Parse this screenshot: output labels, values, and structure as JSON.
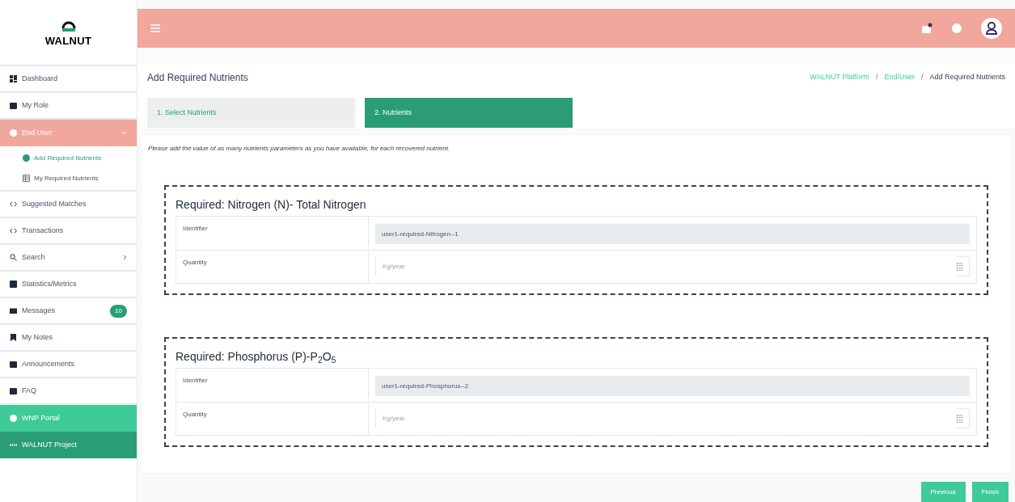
{
  "logo": {
    "text": "WALNUT"
  },
  "sidebar": {
    "items": [
      {
        "kind": "item",
        "label": "Dashboard",
        "selected": false
      },
      {
        "kind": "item",
        "label": "My Role",
        "selected": false
      },
      {
        "kind": "item",
        "label": "End User",
        "selected": true,
        "expanded": true,
        "children": [
          {
            "label": "Add Required Nutrients",
            "selected": true
          },
          {
            "label": "My Required Nutrients",
            "selected": false
          }
        ]
      },
      {
        "kind": "item",
        "label": "Suggested Matches",
        "selected": false
      },
      {
        "kind": "item",
        "label": "Transactions",
        "selected": false
      },
      {
        "kind": "item",
        "label": "Search",
        "selected": false,
        "submenu": true
      },
      {
        "kind": "item",
        "label": "Statistics/Metrics",
        "selected": false
      },
      {
        "kind": "item",
        "label": "Messages",
        "selected": false,
        "badge": "10"
      },
      {
        "kind": "item",
        "label": "My Notes",
        "selected": false
      },
      {
        "kind": "item",
        "label": "Announcements",
        "selected": false
      },
      {
        "kind": "item",
        "label": "FAQ",
        "selected": false
      },
      {
        "kind": "portal",
        "label": "WNP Portal",
        "selected": false
      },
      {
        "kind": "project",
        "label": "WALNUT Project",
        "selected": false
      }
    ]
  },
  "page": {
    "title": "Add Required Nutrients",
    "breadcrumb": [
      {
        "label": "WALNUT Platform",
        "link": true
      },
      {
        "label": "/",
        "kind": "separator"
      },
      {
        "label": "End/User",
        "link": true
      },
      {
        "label": "/",
        "kind": "separator"
      },
      {
        "label": "Add Required Nutrients",
        "link": false
      }
    ]
  },
  "tabs": [
    {
      "label": "1. Select Nutrients",
      "selected": false
    },
    {
      "label": "2. Nutrients",
      "selected": true
    }
  ],
  "instructions": "Please add the value of as many nutrients parameters as you have available, for each recovered nutrient.",
  "sections": [
    {
      "title": "Required: Nitrogen (N)- Total Nitrogen",
      "fields": [
        {
          "label": "Identifier",
          "kind": "readonly",
          "value": "user1-required-Nitrogen--1"
        },
        {
          "label": "Quantity",
          "kind": "number",
          "placeholder": "Kg/year"
        }
      ]
    },
    {
      "title": "Required: Phosphorus (P)-P$_{2}$O$_{5}$",
      "fields": [
        {
          "label": "Identifier",
          "kind": "readonly",
          "value": "user1-required-Phosphorus--2"
        },
        {
          "label": "Quantity",
          "kind": "number",
          "placeholder": "Kg/year"
        }
      ]
    }
  ],
  "buttons": [
    "Previous",
    "Finish"
  ]
}
